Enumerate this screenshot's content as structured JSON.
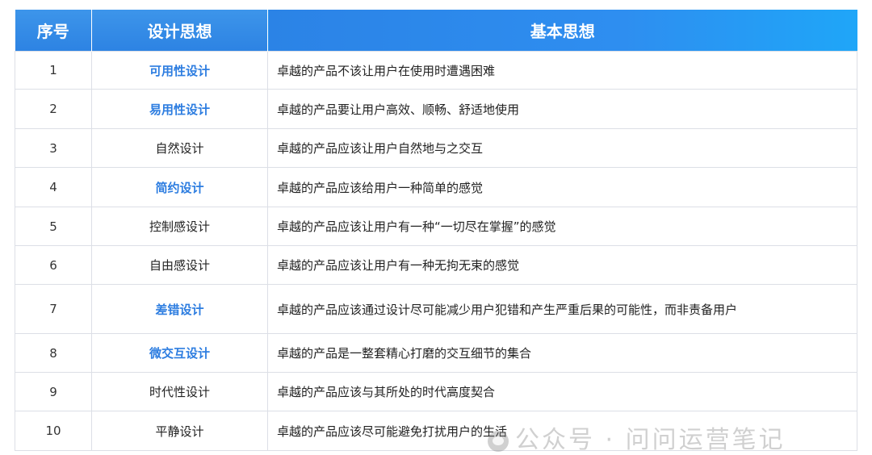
{
  "table": {
    "headers": [
      "序号",
      "设计思想",
      "基本思想"
    ],
    "rows": [
      {
        "num": "1",
        "name": "可用性设计",
        "desc": "卓越的产品不该让用户在使用时遭遇困难",
        "highlight": true
      },
      {
        "num": "2",
        "name": "易用性设计",
        "desc": "卓越的产品要让用户高效、顺畅、舒适地使用",
        "highlight": true
      },
      {
        "num": "3",
        "name": "自然设计",
        "desc": "卓越的产品应该让用户自然地与之交互",
        "highlight": false
      },
      {
        "num": "4",
        "name": "简约设计",
        "desc": "卓越的产品应该给用户一种简单的感觉",
        "highlight": true
      },
      {
        "num": "5",
        "name": "控制感设计",
        "desc": "卓越的产品应该让用户有一种“一切尽在掌握”的感觉",
        "highlight": false
      },
      {
        "num": "6",
        "name": "自由感设计",
        "desc": "卓越的产品应该让用户有一种无拘无束的感觉",
        "highlight": false
      },
      {
        "num": "7",
        "name": "差错设计",
        "desc": "卓越的产品应该通过设计尽可能减少用户犯错和产生严重后果的可能性，而非责备用户",
        "highlight": true
      },
      {
        "num": "8",
        "name": "微交互设计",
        "desc": "卓越的产品是一整套精心打磨的交互细节的集合",
        "highlight": true
      },
      {
        "num": "9",
        "name": "时代性设计",
        "desc": "卓越的产品应该与其所处的时代高度契合",
        "highlight": false
      },
      {
        "num": "10",
        "name": "平静设计",
        "desc": "卓越的产品应该尽可能避免打扰用户的生活",
        "highlight": false
      }
    ],
    "row_heights": "layout-only"
  },
  "watermark": {
    "text": "公众号 · 问问运营笔记"
  },
  "colors": {
    "header_bg": "#2d83e3",
    "highlight_text": "#2d7de0",
    "border": "#dcdfe6"
  }
}
